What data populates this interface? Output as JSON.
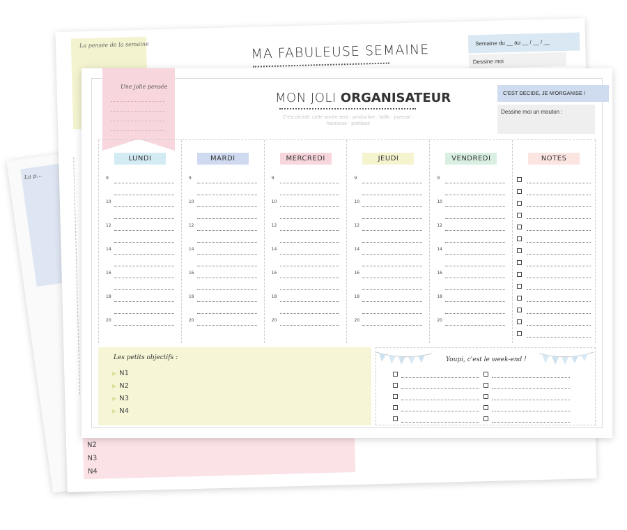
{
  "back_sheet": {
    "label": "La p..."
  },
  "middle_sheet": {
    "corner_label": "La pensée de la semaine",
    "title": "MA FABULEUSE SEMAINE",
    "week_label": "Semaine du __ au __ / __ / __",
    "dessine_label": "Dessine moi",
    "objectives": [
      "N2",
      "N3",
      "N4"
    ]
  },
  "front_sheet": {
    "ribbon_label": "Une jolie pensée",
    "title_prefix": "MON JOLI ",
    "title_bold": "ORGANISATEUR",
    "subtitle": "C'est décidé, cette année sera : productive · belle · joyeuse · heureuse · poétique",
    "decide_label": "C'EST DECIDE, JE M'ORGANISE !",
    "mouton_label": "Dessine moi un mouton :",
    "days": [
      {
        "name": "LUNDI",
        "color": "#d3ebf2"
      },
      {
        "name": "MARDI",
        "color": "#cfdaf0"
      },
      {
        "name": "MERCREDI",
        "color": "#f7d7dd"
      },
      {
        "name": "JEUDI",
        "color": "#f6f4cf"
      },
      {
        "name": "VENDREDI",
        "color": "#d9efe2"
      }
    ],
    "notes_label": "NOTES",
    "notes_color": "#fbe5e0",
    "hours": [
      "9",
      "",
      "10",
      "",
      "12",
      "",
      "14",
      "",
      "16",
      "",
      "18",
      "",
      "20"
    ],
    "objectives_title": "Les petits objectifs :",
    "objectives": [
      "N1",
      "N2",
      "N3",
      "N4"
    ],
    "weekend_title": "Youpi, c'est le week-end !"
  },
  "colors": {
    "pink": "#f7d7dd",
    "yellow": "#f6f6d6",
    "blue": "#cfdcef"
  }
}
